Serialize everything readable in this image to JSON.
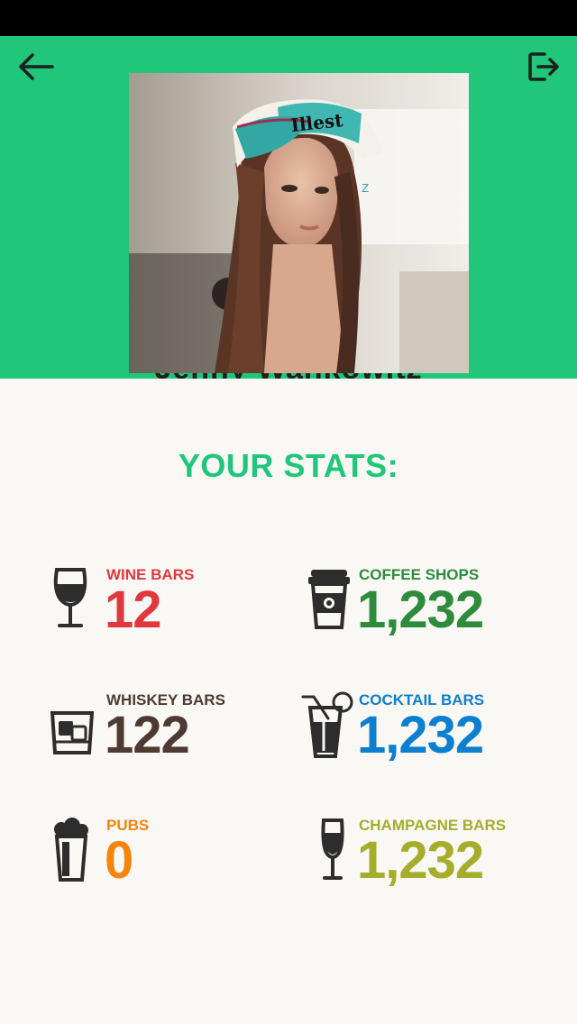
{
  "profile": {
    "name": "Jenny Wankowitz"
  },
  "stats_title": "YOUR STATS:",
  "stats": [
    {
      "label": "WINE BARS",
      "value": "12",
      "color": "#e0383e",
      "icon": "wine-glass-icon"
    },
    {
      "label": "COFFEE SHOPS",
      "value": "1,232",
      "color": "#2e8b3c",
      "icon": "coffee-cup-icon"
    },
    {
      "label": "WHISKEY BARS",
      "value": "122",
      "color": "#4e3a33",
      "icon": "whiskey-glass-icon"
    },
    {
      "label": "COCKTAIL BARS",
      "value": "1,232",
      "color": "#0c7fd0",
      "icon": "cocktail-icon"
    },
    {
      "label": "PUBS",
      "value": "0",
      "color": "#f5840c",
      "icon": "beer-glass-icon"
    },
    {
      "label": "CHAMPAGNE BARS",
      "value": "1,232",
      "color": "#a5ad2a",
      "icon": "champagne-flute-icon"
    }
  ],
  "colors": {
    "header_bg": "#20c679",
    "page_bg": "#f9f8f4",
    "title": "#20c679",
    "icon": "#2d2d2d"
  }
}
